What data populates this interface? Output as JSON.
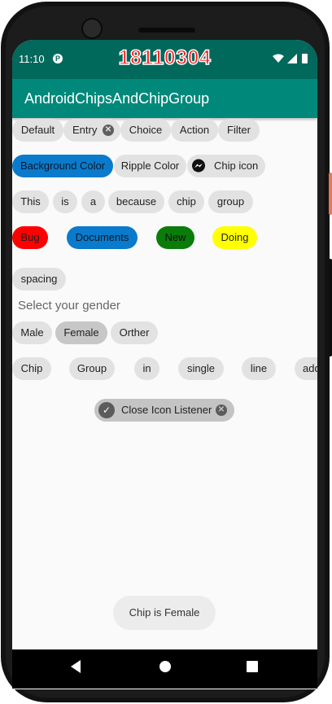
{
  "status_bar": {
    "time": "11:10",
    "watermark": "18110304",
    "color": "#00695c",
    "icons": [
      "p-badge-icon",
      "wifi-icon",
      "signal-icon",
      "battery-icon"
    ]
  },
  "app_bar": {
    "title": "AndroidChipsAndChipGroup",
    "color": "#00897b"
  },
  "chip_rows": {
    "row1": [
      "Default",
      "Entry",
      "Choice",
      "Action",
      "Filter"
    ],
    "row2": [
      "Background Color",
      "Ripple Color",
      "Chip icon"
    ],
    "row3": [
      "This",
      "is",
      "a",
      "because",
      "chip",
      "group"
    ],
    "row4": [
      "Bug",
      "Documents",
      "New",
      "Doing"
    ],
    "row5": [
      "spacing"
    ],
    "gender_label": "Select your gender",
    "gender": [
      "Male",
      "Female",
      "Orther"
    ],
    "row7": [
      "Chip",
      "Group",
      "in",
      "single",
      "line",
      "add"
    ],
    "close_listener": "Close Icon Listener"
  },
  "colors": {
    "chip_default": "#e2e2e2",
    "background_color_chip": "#0a7acc",
    "bug": "#ff0000",
    "documents": "#0a7acc",
    "new": "#0a7c0a",
    "doing": "#ffff00",
    "female_selected": "#c7c7c7"
  },
  "toast": "Chip is Female",
  "nav": [
    "back-icon",
    "home-icon",
    "recents-icon"
  ]
}
